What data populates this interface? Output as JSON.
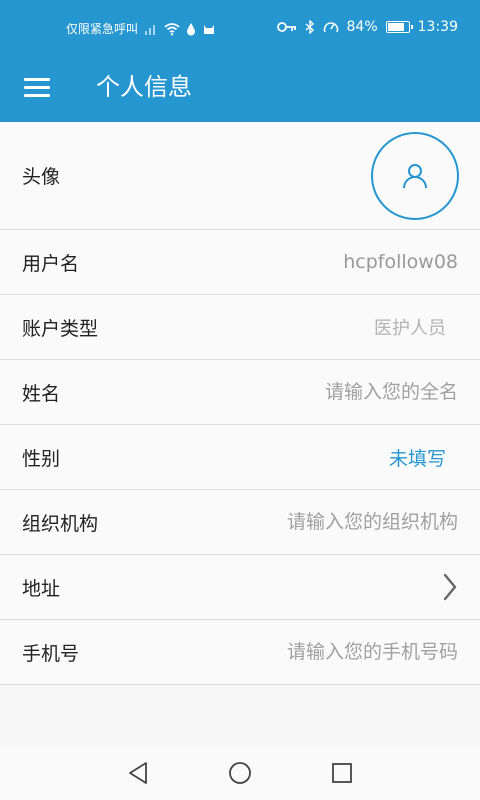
{
  "status_bar": {
    "left_text": "仅限紧急呼叫",
    "battery": "84%",
    "battery_level": 0.84,
    "time": "13:39"
  },
  "app_bar": {
    "title": "个人信息"
  },
  "rows": {
    "avatar": {
      "label": "头像"
    },
    "username": {
      "label": "用户名",
      "value": "hcpfollow08"
    },
    "account_type": {
      "label": "账户类型",
      "value": "医护人员"
    },
    "name": {
      "label": "姓名",
      "placeholder": "请输入您的全名"
    },
    "gender": {
      "label": "性别",
      "value": "未填写"
    },
    "organization": {
      "label": "组织机构",
      "placeholder": "请输入您的组织机构"
    },
    "address": {
      "label": "地址"
    },
    "phone": {
      "label": "手机号",
      "placeholder": "请输入您的手机号码"
    }
  },
  "colors": {
    "primary": "#2596cf",
    "divider": "#dcdcdc"
  }
}
